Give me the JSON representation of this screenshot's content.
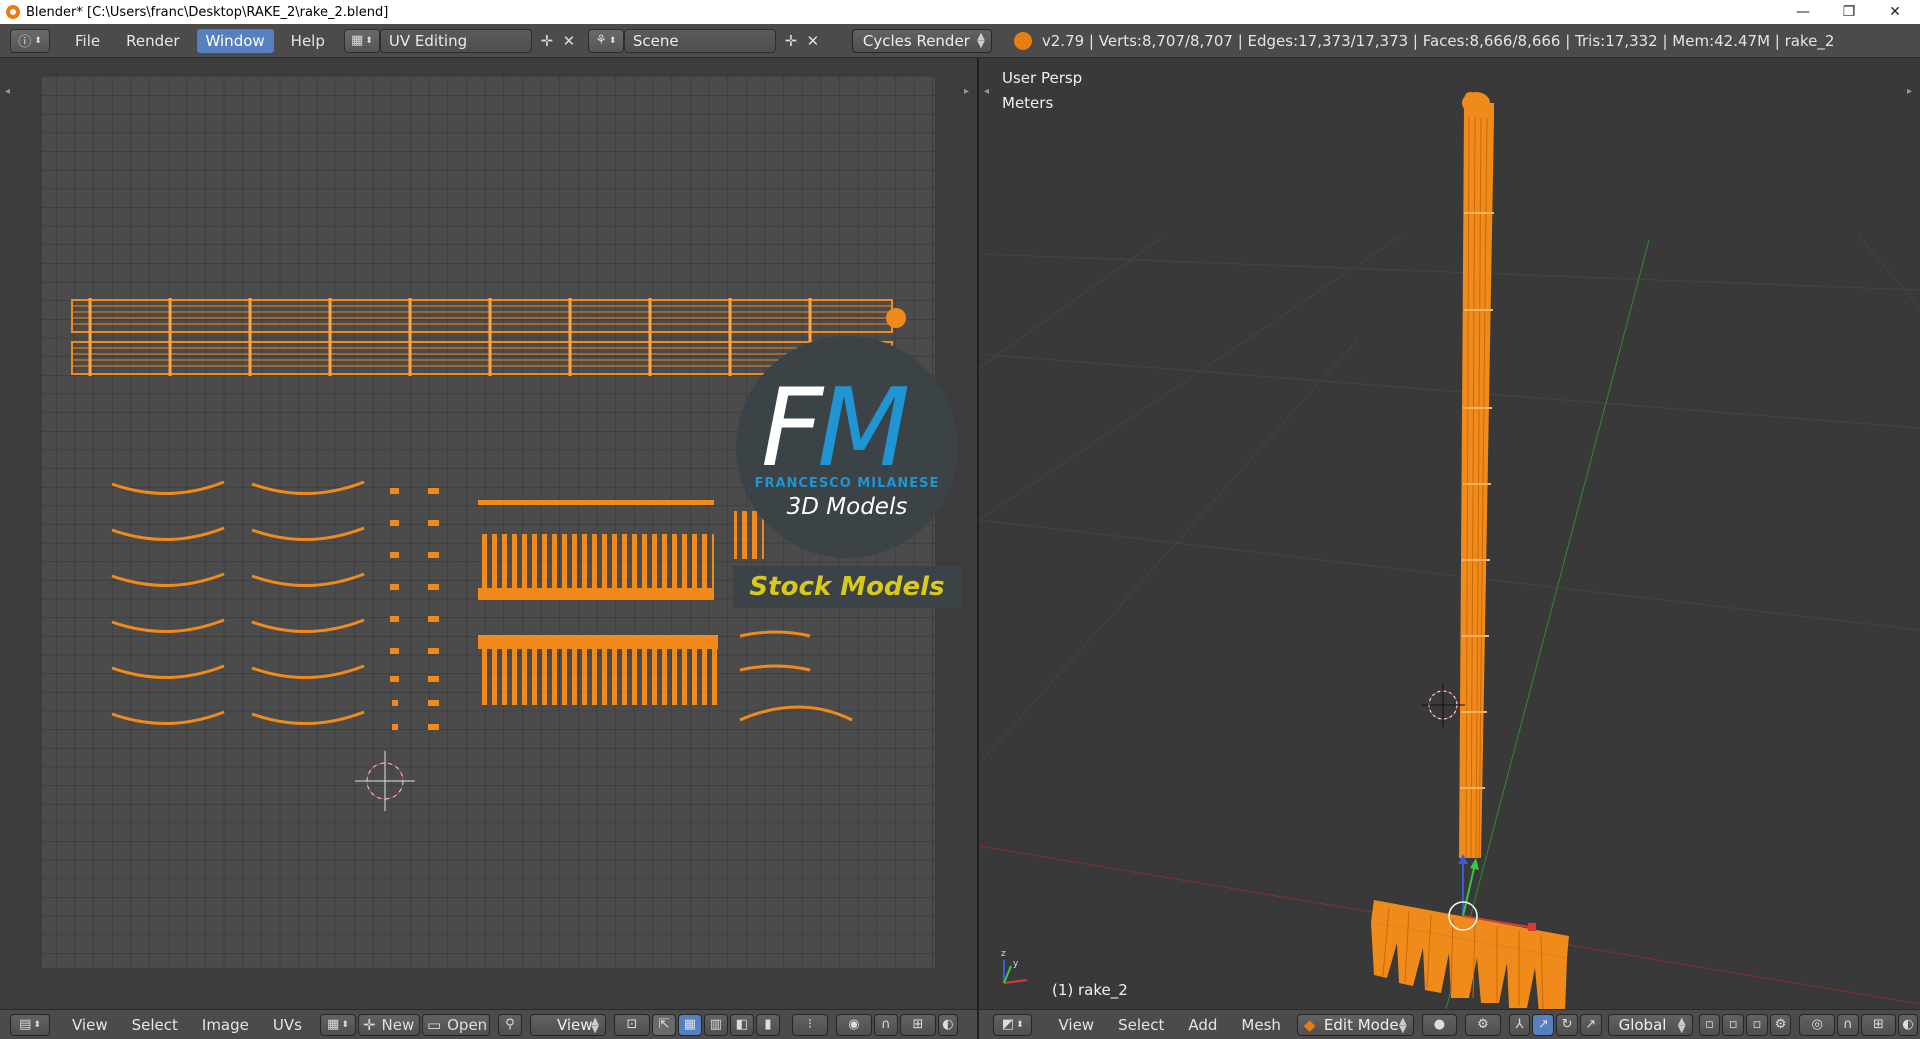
{
  "window": {
    "title": "Blender* [C:\\Users\\franc\\Desktop\\RAKE_2\\rake_2.blend]",
    "controls": {
      "minimize": "—",
      "restore": "❐",
      "close": "✕"
    }
  },
  "info_header": {
    "menus": [
      "File",
      "Render",
      "Window",
      "Help"
    ],
    "active_menu": "Window",
    "screen_layout": "UV Editing",
    "scene": "Scene",
    "render_engine": "Cycles Render",
    "stats": "v2.79 | Verts:8,707/8,707 | Edges:17,373/17,373 | Faces:8,666/8,666 | Tris:17,332 | Mem:42.47M | rake_2"
  },
  "uv_editor": {
    "header": {
      "menus": [
        "View",
        "Select",
        "Image",
        "UVs"
      ],
      "new_label": "New",
      "open_label": "Open",
      "view_label": "View"
    }
  },
  "viewport": {
    "view_name": "User Persp",
    "units": "Meters",
    "object_label": "(1) rake_2",
    "header": {
      "menus": [
        "View",
        "Select",
        "Add",
        "Mesh"
      ],
      "mode": "Edit Mode",
      "orientation": "Global"
    }
  },
  "watermark": {
    "brand": "FRANCESCO MILANESE",
    "subtitle": "3D Models",
    "tagline": "Stock Models",
    "logo_letters": [
      "F",
      "M"
    ]
  },
  "colors": {
    "accent": "#e87d0d",
    "uv_mesh": "#f08a1a",
    "active_menu": "#5680c2",
    "brand_blue": "#1f95d3",
    "tagline_yellow": "#d9c91a"
  }
}
